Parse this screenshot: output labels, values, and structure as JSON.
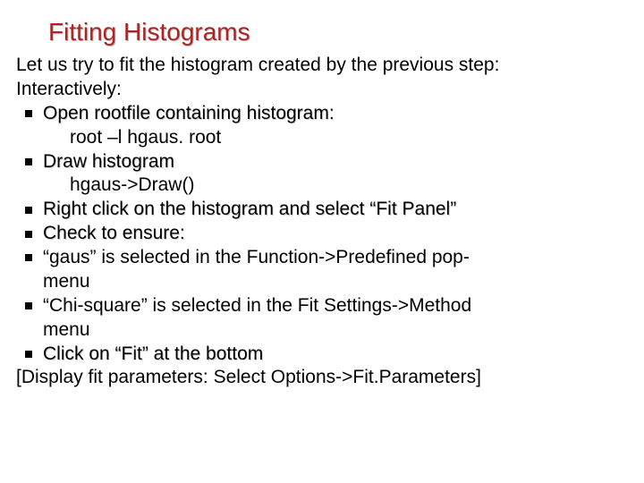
{
  "title": "Fitting Histograms",
  "intro_line1": "Let us try to fit the histogram created by the previous step:",
  "intro_line2": "Interactively:",
  "items": [
    {
      "step": "Open rootfile containing histogram:",
      "sub": "root –l hgaus. root"
    },
    {
      "step": "Draw histogram",
      "sub": "hgaus->Draw()"
    },
    {
      "step": "Right click on the histogram and select “Fit Panel”",
      "sub": ""
    },
    {
      "step": "Check to ensure:",
      "sub": ""
    },
    {
      "plain_pre": "“gaus” is selected in the Function->Predefined pop-",
      "plain_post": "menu"
    },
    {
      "plain_pre": "“Chi-square” is selected in the Fit Settings->Method ",
      "plain_post": "menu"
    },
    {
      "step": "Click on “Fit” at the bottom",
      "sub": ""
    }
  ],
  "footer": "[Display fit parameters: Select Options->Fit.Parameters]"
}
